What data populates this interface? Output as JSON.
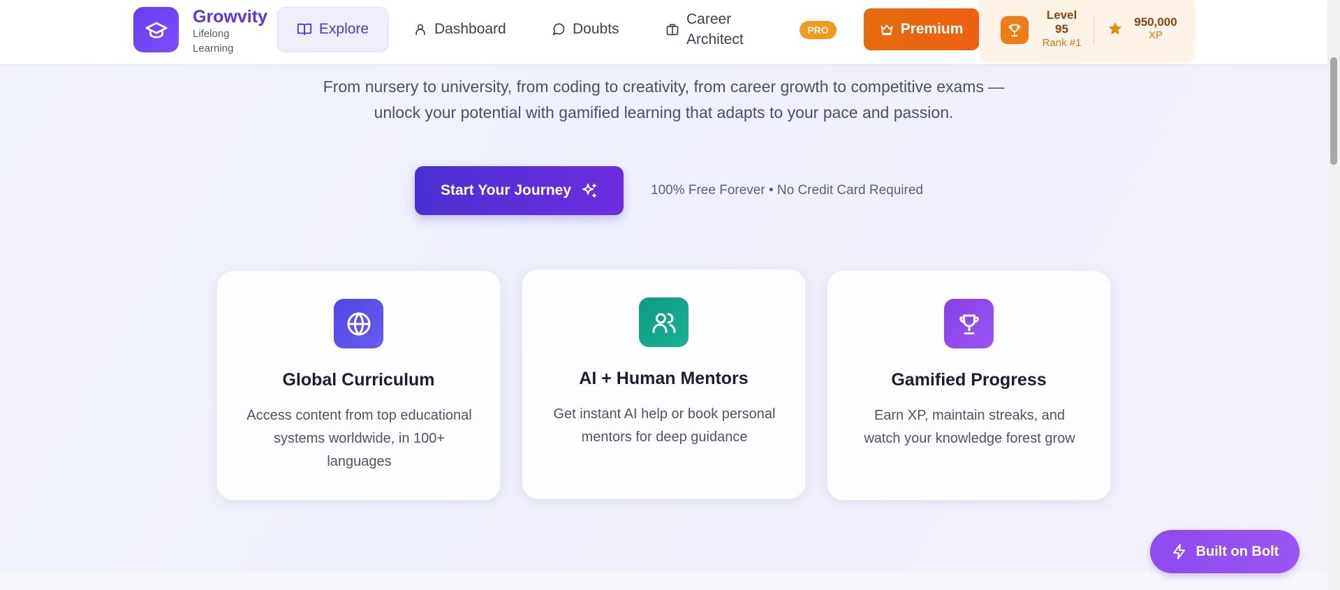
{
  "brand": {
    "name": "Growvity",
    "tagline": "Lifelong Learning",
    "logo_icon": "graduation-cap-icon",
    "accent": "#5b33e3"
  },
  "nav": {
    "items": [
      {
        "label": "Explore",
        "icon": "book-open-icon",
        "active": true
      },
      {
        "label": "Dashboard",
        "icon": "user-icon",
        "active": false
      },
      {
        "label": "Doubts",
        "icon": "chat-bubble-icon",
        "active": false
      },
      {
        "label": "Career Architect",
        "icon": "briefcase-icon",
        "active": false
      }
    ],
    "pro_badge": "PRO",
    "premium_label": "Premium",
    "premium_icon": "crown-icon"
  },
  "stats": {
    "level_label": "Level",
    "level_value": "95",
    "rank": "Rank #1",
    "xp_value": "950,000",
    "xp_label": "XP",
    "trophy_icon": "trophy-icon",
    "star_icon": "star-icon"
  },
  "hero": {
    "subtitle_line1": "From nursery to university, from coding to creativity, from career growth to competitive exams —",
    "subtitle_line2": "unlock your potential with gamified learning that adapts to your pace and passion.",
    "cta_label": "Start Your Journey",
    "cta_icon": "sparkles-icon",
    "cta_note": "100% Free Forever • No Credit Card Required"
  },
  "features": [
    {
      "title": "Global Curriculum",
      "description": "Access content from top educational systems worldwide, in 100+ languages",
      "icon": "globe-icon",
      "color": "#5b4ef0"
    },
    {
      "title": "AI + Human Mentors",
      "description": "Get instant AI help or book personal mentors for deep guidance",
      "icon": "users-icon",
      "color": "#12a58a"
    },
    {
      "title": "Gamified Progress",
      "description": "Earn XP, maintain streaks, and watch your knowledge forest grow",
      "icon": "trophy-icon",
      "color": "#8a45ea"
    }
  ],
  "floating": {
    "bolt_label": "Built on Bolt",
    "bolt_icon": "lightning-icon"
  }
}
